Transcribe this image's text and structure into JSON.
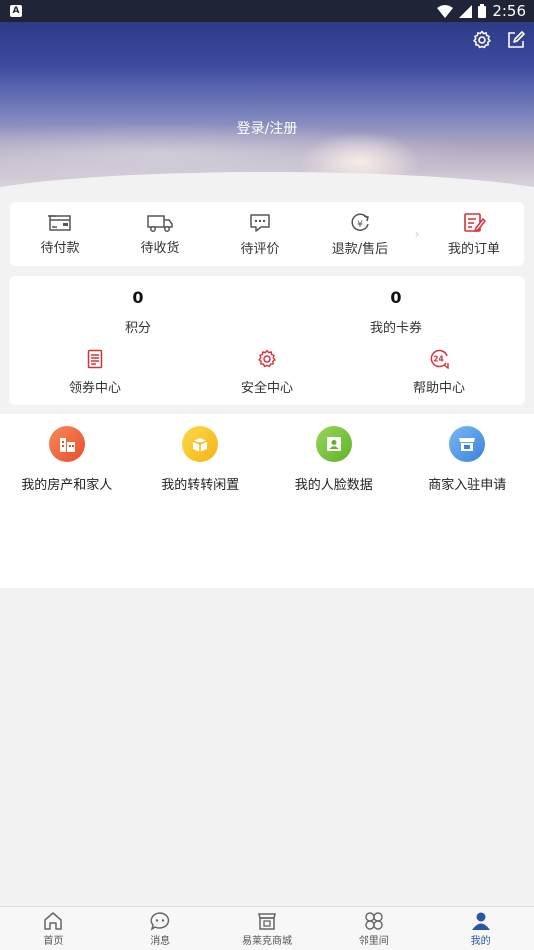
{
  "status_bar": {
    "time": "2:56",
    "left_badge": "A"
  },
  "header": {
    "login_label": "登录/注册"
  },
  "orders": {
    "items": [
      {
        "label": "待付款",
        "icon": "wallet-icon"
      },
      {
        "label": "待收货",
        "icon": "truck-icon"
      },
      {
        "label": "待评价",
        "icon": "comment-icon"
      },
      {
        "label": "退款/售后",
        "icon": "refund-icon"
      }
    ],
    "my_orders_label": "我的订单"
  },
  "assets": {
    "points_value": "0",
    "points_label": "积分",
    "coupons_value": "0",
    "coupons_label": "我的卡券"
  },
  "services": [
    {
      "label": "领券中心",
      "icon": "coupon-center-icon"
    },
    {
      "label": "安全中心",
      "icon": "security-gear-icon"
    },
    {
      "label": "帮助中心",
      "icon": "help-24h-icon"
    }
  ],
  "features": [
    {
      "label": "我的房产和家人",
      "icon": "building-icon",
      "color": "#f0613a"
    },
    {
      "label": "我的转转闲置",
      "icon": "gift-box-icon",
      "color": "#f7c325"
    },
    {
      "label": "我的人脸数据",
      "icon": "face-id-icon",
      "color": "#7cc43a"
    },
    {
      "label": "商家入驻申请",
      "icon": "store-icon",
      "color": "#4a90e2"
    }
  ],
  "tabbar": [
    {
      "label": "首页",
      "icon": "home-icon"
    },
    {
      "label": "消息",
      "icon": "chat-icon"
    },
    {
      "label": "易莱克商城",
      "icon": "shop-icon"
    },
    {
      "label": "邻里间",
      "icon": "neighbor-icon"
    },
    {
      "label": "我的",
      "icon": "person-icon",
      "active": true
    }
  ],
  "colors": {
    "accent_red": "#d9303a",
    "active_tab": "#2b56a6"
  }
}
